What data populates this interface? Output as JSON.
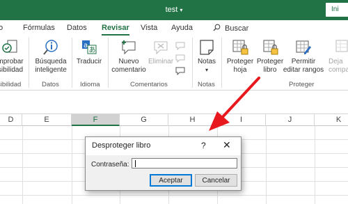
{
  "title_bar": {
    "doc_title": "test",
    "title_dropdown": "▾",
    "signin_label": "Ini"
  },
  "tabs": [
    {
      "label": "o"
    },
    {
      "label": "Fórmulas"
    },
    {
      "label": "Datos"
    },
    {
      "label": "Revisar"
    },
    {
      "label": "Vista"
    },
    {
      "label": "Ayuda"
    }
  ],
  "search": {
    "label": "Buscar"
  },
  "ribbon": {
    "buttons": {
      "accessibility": {
        "line1": "mprobar",
        "line2": "sibilidad"
      },
      "smart_lookup": {
        "line1": "Búsqueda",
        "line2": "inteligente"
      },
      "translate": {
        "line1": "Traducir"
      },
      "new_comment": {
        "line1": "Nuevo",
        "line2": "comentario"
      },
      "delete": {
        "line1": "Eliminar"
      },
      "notes": {
        "line1": "Notas",
        "line2": "▾"
      },
      "protect_sheet": {
        "line1": "Proteger",
        "line2": "hoja"
      },
      "protect_book": {
        "line1": "Proteger",
        "line2": "libro"
      },
      "allow_edit": {
        "line1": "Permitir",
        "line2": "editar rangos"
      },
      "share": {
        "line1": "Deja",
        "line2": "compart"
      }
    },
    "groups": {
      "accessibility": "sibilidad",
      "data": "Datos",
      "language": "Idioma",
      "comments": "Comentarios",
      "notes": "Notas",
      "protect": "Proteger"
    }
  },
  "columns": [
    "D",
    "E",
    "F",
    "G",
    "H",
    "I",
    "J",
    "K"
  ],
  "selected_column": "F",
  "dialog": {
    "title": "Desproteger libro",
    "help": "?",
    "close": "✕",
    "password_label": "Contraseña:",
    "password_value": "",
    "ok_label": "Aceptar",
    "cancel_label": "Cancelar"
  },
  "colors": {
    "excel_green": "#217346",
    "arrow_red": "#e8191e",
    "dialog_focus": "#0078d7"
  }
}
